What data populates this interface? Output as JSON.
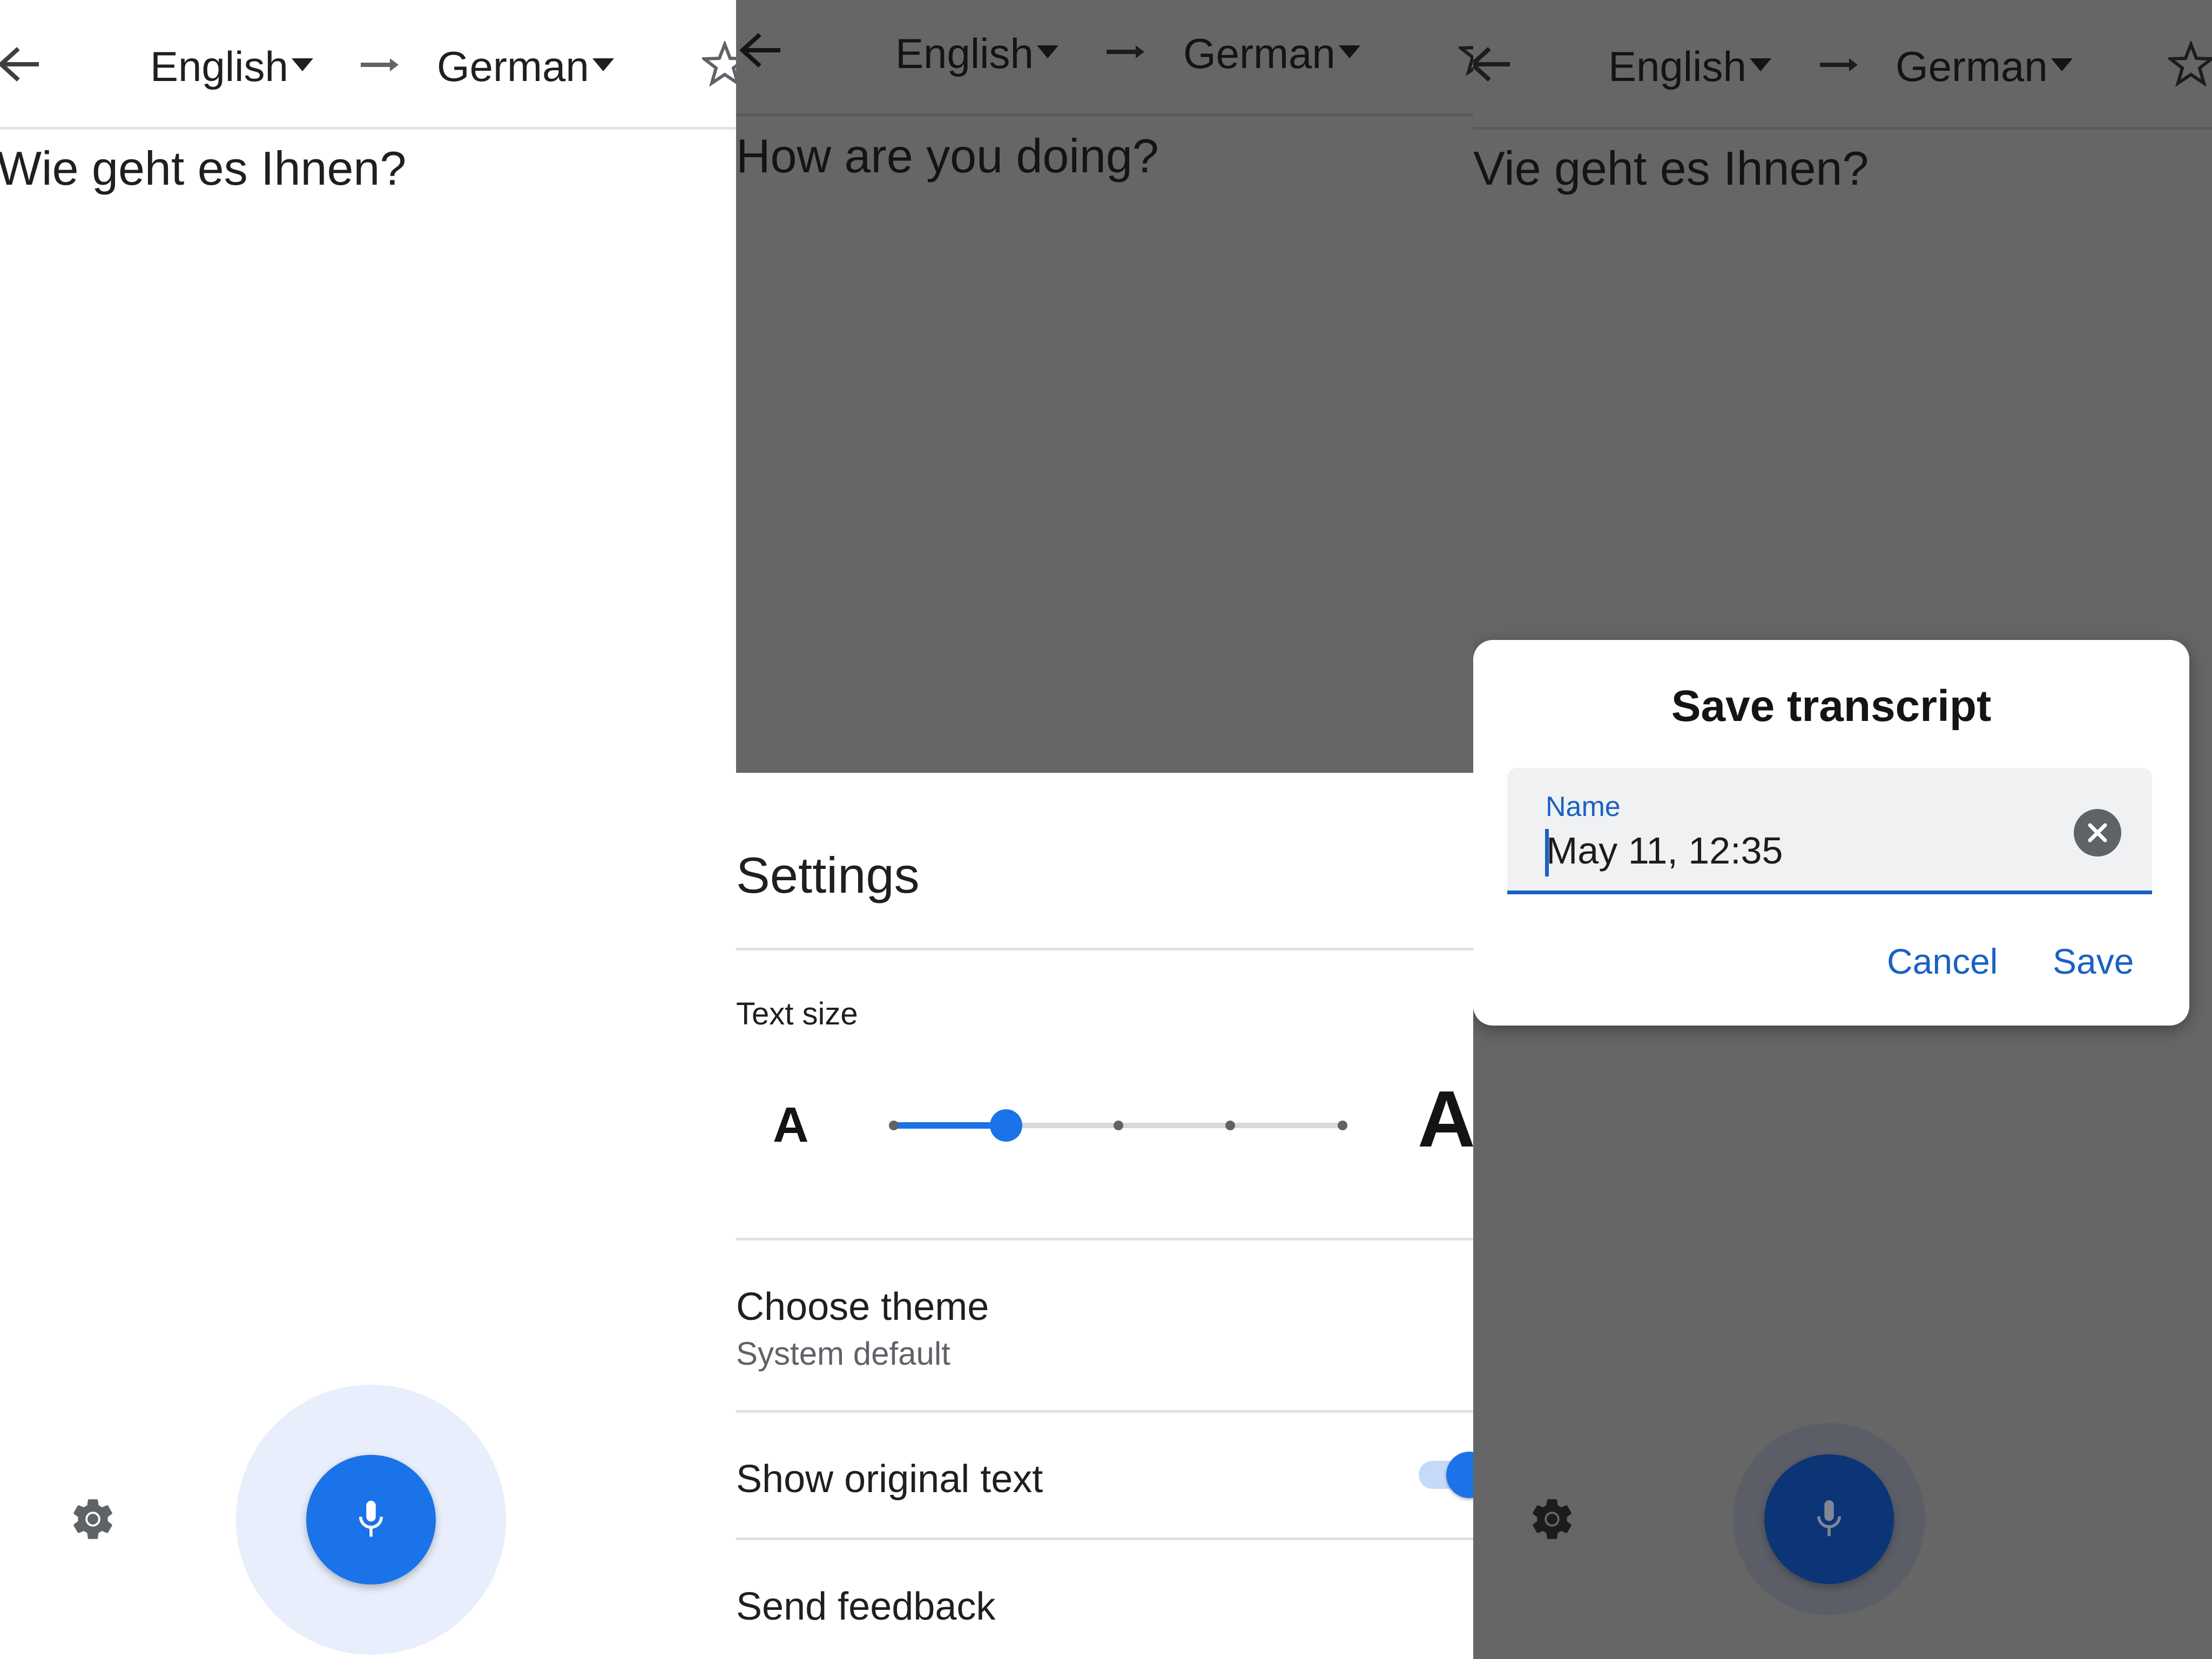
{
  "panels": [
    {
      "id": "transcribe-main",
      "header": {
        "back_icon": "arrow-back-icon",
        "source_language": "English",
        "direction_icon": "arrow-right-icon",
        "target_language": "German",
        "favorite_icon": "star-outline-icon"
      },
      "transcript_text": "Wie geht es Ihnen?",
      "bottom_bar": {
        "settings_icon": "gear-icon",
        "mic_icon": "microphone-icon"
      }
    },
    {
      "id": "settings-sheet",
      "header": {
        "back_icon": "arrow-back-icon",
        "source_language": "English",
        "direction_icon": "arrow-right-icon",
        "target_language": "German",
        "favorite_icon": "star-outline-icon"
      },
      "transcript_text": "How are you doing?",
      "settings": {
        "title": "Settings",
        "text_size": {
          "label": "Text size",
          "small_glyph": "A",
          "large_glyph": "A",
          "steps": 5,
          "selected_step": 1
        },
        "theme": {
          "label": "Choose theme",
          "value": "System default"
        },
        "show_original_text": {
          "label": "Show original text",
          "enabled": true
        },
        "send_feedback": {
          "label": "Send feedback"
        }
      }
    },
    {
      "id": "save-dialog",
      "header": {
        "back_icon": "arrow-back-icon",
        "source_language": "English",
        "direction_icon": "arrow-right-icon",
        "target_language": "German",
        "favorite_icon": "star-outline-icon"
      },
      "transcript_text": "Vie geht es Ihnen?",
      "dialog": {
        "title": "Save transcript",
        "field_label": "Name",
        "field_value": "May 11, 12:35",
        "clear_icon": "clear-circle-icon",
        "cancel_label": "Cancel",
        "save_label": "Save"
      },
      "bottom_bar": {
        "settings_icon": "gear-icon",
        "mic_icon": "microphone-icon"
      }
    }
  ],
  "colors": {
    "accent": "#1a73e8",
    "accent_dark": "#1a61c4",
    "mic_halo": "#e8eefb",
    "scrim": "#666666",
    "divider": "#e0e0e0",
    "secondary_text": "#5f6368"
  }
}
